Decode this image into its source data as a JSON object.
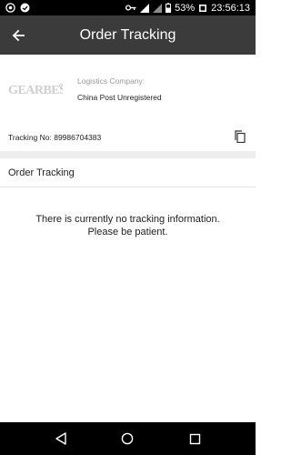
{
  "status_bar": {
    "battery": "53%",
    "time": "23:56:13",
    "icons": [
      "notification-icon",
      "notification-icon",
      "key-icon",
      "signal-icon",
      "signal-icon",
      "battery-icon"
    ]
  },
  "app_bar": {
    "title": "Order Tracking",
    "back_icon": "arrow-left-icon"
  },
  "logistics": {
    "logo_text": "GEARBEST",
    "company_label": "Logistics Company:",
    "company_value": "China Post Unregistered"
  },
  "tracking": {
    "label": "Tracking No: 89986704383",
    "copy_icon": "copy-icon"
  },
  "section": {
    "title": "Order Tracking"
  },
  "empty_state": {
    "line1": "There is currently no tracking information.",
    "line2": "Please be patient."
  },
  "nav_bar": {
    "icons": [
      "back-triangle-icon",
      "home-circle-icon",
      "recents-square-icon"
    ]
  },
  "colors": {
    "app_bar": "#3b3b3b",
    "status_bar": "#000000",
    "divider": "#eeeeee"
  }
}
